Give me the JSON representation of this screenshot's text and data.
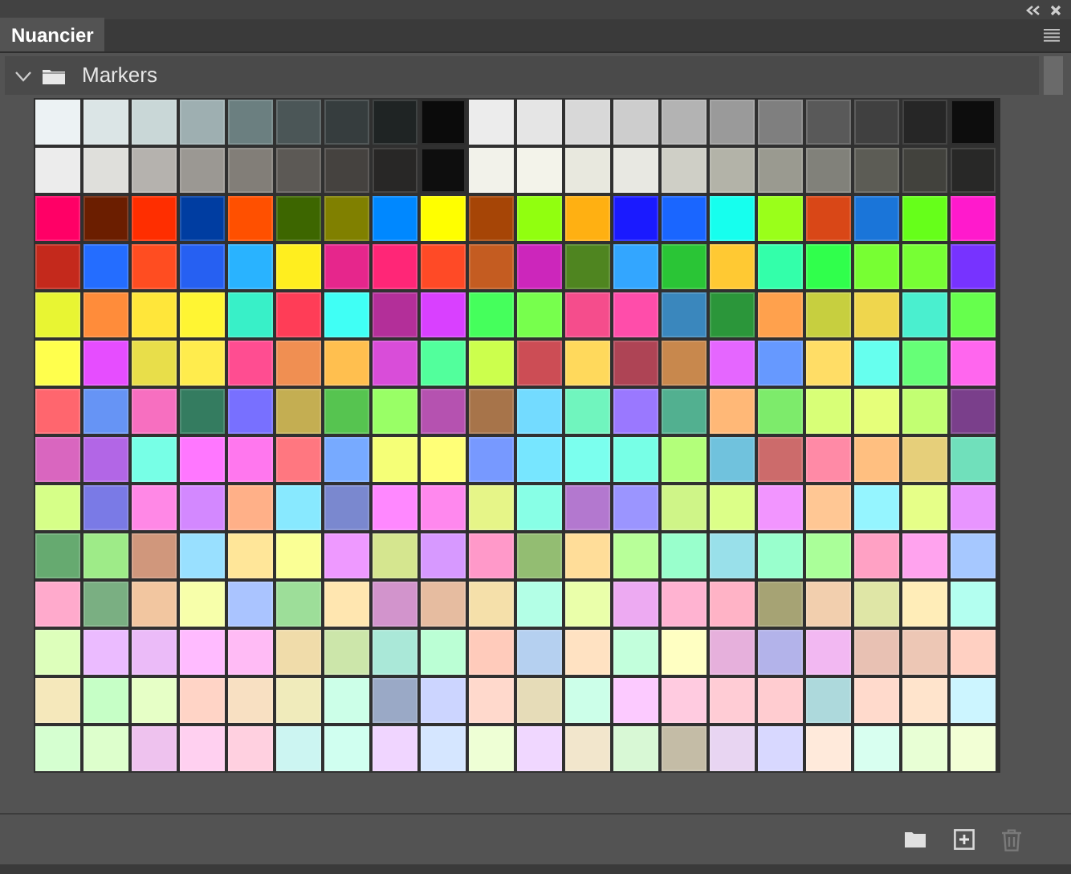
{
  "tab": {
    "title": "Nuancier",
    "selected": true
  },
  "group": {
    "name": "Markers",
    "expanded": true
  },
  "rows": [
    {
      "swatches": [
        {
          "color": "#ecf2f4"
        },
        {
          "color": "#dbe5e6"
        },
        {
          "color": "#c9d7d7"
        },
        {
          "color": "#9eafb1"
        },
        {
          "color": "#6b7f80"
        },
        {
          "color": "#4b5657"
        },
        {
          "color": "#363d3e"
        },
        {
          "color": "#1f2424"
        },
        {
          "color": "#0b0b0b"
        },
        {
          "color": "#ececec"
        },
        {
          "color": "#e5e5e5"
        },
        {
          "color": "#d8d8d8"
        },
        {
          "color": "#cdcdcd"
        },
        {
          "color": "#b3b3b3"
        },
        {
          "color": "#9a9a9a"
        },
        {
          "color": "#7f7f7f"
        },
        {
          "color": "#595959"
        },
        {
          "color": "#404040"
        },
        {
          "color": "#262626"
        },
        {
          "color": "#0d0d0d"
        }
      ]
    },
    {
      "swatches": [
        {
          "color": "#ececec"
        },
        {
          "color": "#dfdfdb"
        },
        {
          "color": "#b5b2ae"
        },
        {
          "color": "#9b9893"
        },
        {
          "color": "#827e78"
        },
        {
          "color": "#5c5955"
        },
        {
          "color": "#45423f"
        },
        {
          "color": "#282726"
        },
        {
          "color": "#0e0e0e"
        },
        {
          "color": "#f2f2ea"
        },
        {
          "color": "#f3f3ea"
        },
        {
          "color": "#e8e8de"
        },
        {
          "color": "#e8e8e2"
        },
        {
          "color": "#cfcfc6"
        },
        {
          "color": "#b3b3a8"
        },
        {
          "color": "#9a9a90"
        },
        {
          "color": "#81817a"
        },
        {
          "color": "#5c5c55"
        },
        {
          "color": "#42423d"
        },
        {
          "color": "#282827"
        }
      ]
    },
    {
      "swatches": [
        {
          "color": "#ff0066"
        },
        {
          "color": "#6b1e00"
        },
        {
          "color": "#ff2e00"
        },
        {
          "color": "#003da1"
        },
        {
          "color": "#ff5000"
        },
        {
          "color": "#3d6600"
        },
        {
          "color": "#808000"
        },
        {
          "color": "#0088ff"
        },
        {
          "color": "#ffff00"
        },
        {
          "color": "#a64506"
        },
        {
          "color": "#91ff0f"
        },
        {
          "color": "#ffb012"
        },
        {
          "color": "#1a1aff"
        },
        {
          "color": "#1a66ff"
        },
        {
          "color": "#16ffee"
        },
        {
          "color": "#9aff1a"
        },
        {
          "color": "#d94717"
        },
        {
          "color": "#1a75d9"
        },
        {
          "color": "#66ff1a"
        },
        {
          "color": "#ff1acc"
        }
      ]
    },
    {
      "swatches": [
        {
          "color": "#c4291c"
        },
        {
          "color": "#246dff"
        },
        {
          "color": "#ff4d21"
        },
        {
          "color": "#2660f2"
        },
        {
          "color": "#29b3ff"
        },
        {
          "color": "#ffee1f"
        },
        {
          "color": "#e6268c"
        },
        {
          "color": "#ff2677"
        },
        {
          "color": "#ff4a26"
        },
        {
          "color": "#c45c21"
        },
        {
          "color": "#cc26bb"
        },
        {
          "color": "#4f8520"
        },
        {
          "color": "#33a6ff"
        },
        {
          "color": "#2ac536"
        },
        {
          "color": "#ffc933"
        },
        {
          "color": "#33ffaa"
        },
        {
          "color": "#30ff4c"
        },
        {
          "color": "#77ff33"
        },
        {
          "color": "#77ff34"
        },
        {
          "color": "#7733ff"
        }
      ]
    },
    {
      "swatches": [
        {
          "color": "#e8f533"
        },
        {
          "color": "#ff8c3a"
        },
        {
          "color": "#ffe63a"
        },
        {
          "color": "#fff533"
        },
        {
          "color": "#38f0c8"
        },
        {
          "color": "#ff3d57"
        },
        {
          "color": "#40fff5"
        },
        {
          "color": "#b32f99"
        },
        {
          "color": "#d940ff"
        },
        {
          "color": "#45ff5c"
        },
        {
          "color": "#77ff4d"
        },
        {
          "color": "#f54d8c"
        },
        {
          "color": "#ff4daa"
        },
        {
          "color": "#3a87bd"
        },
        {
          "color": "#2b963a"
        },
        {
          "color": "#ffa14d"
        },
        {
          "color": "#c7cf3f"
        },
        {
          "color": "#efd64d"
        },
        {
          "color": "#4aefcf"
        },
        {
          "color": "#66ff4d"
        }
      ]
    },
    {
      "swatches": [
        {
          "color": "#ffff4d"
        },
        {
          "color": "#e64dff"
        },
        {
          "color": "#e8de4a"
        },
        {
          "color": "#ffec4d"
        },
        {
          "color": "#ff4d91"
        },
        {
          "color": "#f08f52"
        },
        {
          "color": "#ffbf4f"
        },
        {
          "color": "#d94dd9"
        },
        {
          "color": "#52ff9c"
        },
        {
          "color": "#ccff4d"
        },
        {
          "color": "#cc4d55"
        },
        {
          "color": "#ffd95c"
        },
        {
          "color": "#ae4455"
        },
        {
          "color": "#c8884d"
        },
        {
          "color": "#e566ff"
        },
        {
          "color": "#6699ff"
        },
        {
          "color": "#ffdd66"
        },
        {
          "color": "#66ffee"
        },
        {
          "color": "#66ff77"
        },
        {
          "color": "#ff66ee"
        }
      ]
    },
    {
      "swatches": [
        {
          "color": "#ff666e"
        },
        {
          "color": "#6694f5"
        },
        {
          "color": "#f76fc0"
        },
        {
          "color": "#347c60"
        },
        {
          "color": "#7870ff"
        },
        {
          "color": "#c4ae52"
        },
        {
          "color": "#56c450"
        },
        {
          "color": "#99ff66"
        },
        {
          "color": "#b552b0"
        },
        {
          "color": "#a7744a"
        },
        {
          "color": "#73dbff"
        },
        {
          "color": "#70f5be"
        },
        {
          "color": "#9a78ff"
        },
        {
          "color": "#52b090"
        },
        {
          "color": "#ffb877"
        },
        {
          "color": "#7deb6b"
        },
        {
          "color": "#d8ff77"
        },
        {
          "color": "#e6ff7a"
        },
        {
          "color": "#c2ff72"
        },
        {
          "color": "#7a3f8b"
        }
      ]
    },
    {
      "swatches": [
        {
          "color": "#d966bf"
        },
        {
          "color": "#b266e6"
        },
        {
          "color": "#77ffe6"
        },
        {
          "color": "#ff77ff"
        },
        {
          "color": "#ff77ee"
        },
        {
          "color": "#ff7780"
        },
        {
          "color": "#77aaff"
        },
        {
          "color": "#f5ff77"
        },
        {
          "color": "#ffff77"
        },
        {
          "color": "#7799ff"
        },
        {
          "color": "#77e6ff"
        },
        {
          "color": "#7bffee"
        },
        {
          "color": "#77ffe6"
        },
        {
          "color": "#b3ff7a"
        },
        {
          "color": "#70c2dd"
        },
        {
          "color": "#cc6b6b"
        },
        {
          "color": "#ff8aa6"
        },
        {
          "color": "#ffbf80"
        },
        {
          "color": "#e6cf7a"
        },
        {
          "color": "#70e0bb"
        }
      ]
    },
    {
      "swatches": [
        {
          "color": "#d6ff88"
        },
        {
          "color": "#7a7ae6"
        },
        {
          "color": "#ff88e6"
        },
        {
          "color": "#d388ff"
        },
        {
          "color": "#ffb088"
        },
        {
          "color": "#88e9ff"
        },
        {
          "color": "#7a88cf"
        },
        {
          "color": "#ff88ff"
        },
        {
          "color": "#ff88ee"
        },
        {
          "color": "#e6f588"
        },
        {
          "color": "#88ffe6"
        },
        {
          "color": "#b378cf"
        },
        {
          "color": "#9b95ff"
        },
        {
          "color": "#cff588"
        },
        {
          "color": "#dcff88"
        },
        {
          "color": "#f295ff"
        },
        {
          "color": "#ffc794"
        },
        {
          "color": "#95f5ff"
        },
        {
          "color": "#e6ff88"
        },
        {
          "color": "#e895ff"
        }
      ]
    },
    {
      "swatches": [
        {
          "color": "#66aa70"
        },
        {
          "color": "#9eeb88"
        },
        {
          "color": "#d0977c"
        },
        {
          "color": "#99e0ff"
        },
        {
          "color": "#ffe699"
        },
        {
          "color": "#faff95"
        },
        {
          "color": "#ee99ff"
        },
        {
          "color": "#d5e68f"
        },
        {
          "color": "#d799ff"
        },
        {
          "color": "#ff99c9"
        },
        {
          "color": "#93bd72"
        },
        {
          "color": "#ffdd99"
        },
        {
          "color": "#b8ff99"
        },
        {
          "color": "#99ffcc"
        },
        {
          "color": "#99e0ea"
        },
        {
          "color": "#99ffcd"
        },
        {
          "color": "#aaff99"
        },
        {
          "color": "#ffa1c4"
        },
        {
          "color": "#ffa3ee"
        },
        {
          "color": "#a6c8ff"
        }
      ]
    },
    {
      "swatches": [
        {
          "color": "#ffaacc"
        },
        {
          "color": "#7aaf82"
        },
        {
          "color": "#f2c6a0"
        },
        {
          "color": "#f7ffaa"
        },
        {
          "color": "#aac4ff"
        },
        {
          "color": "#9dde99"
        },
        {
          "color": "#ffe6b0"
        },
        {
          "color": "#d294cc"
        },
        {
          "color": "#e6bca0"
        },
        {
          "color": "#f5e0aa"
        },
        {
          "color": "#b3ffe6"
        },
        {
          "color": "#eaffaa"
        },
        {
          "color": "#edaaf2"
        },
        {
          "color": "#ffb3d1"
        },
        {
          "color": "#ffb3c6"
        },
        {
          "color": "#a6a374"
        },
        {
          "color": "#f2cfae"
        },
        {
          "color": "#dfe6a6"
        },
        {
          "color": "#ffedb8"
        },
        {
          "color": "#b3fff0"
        }
      ]
    },
    {
      "swatches": [
        {
          "color": "#ddffbb"
        },
        {
          "color": "#ebbbff"
        },
        {
          "color": "#ebbbf8"
        },
        {
          "color": "#ffbbff"
        },
        {
          "color": "#ffbbf5"
        },
        {
          "color": "#f0dcaa"
        },
        {
          "color": "#cce6aa"
        },
        {
          "color": "#aae8d8"
        },
        {
          "color": "#bbffd5"
        },
        {
          "color": "#ffcbbb"
        },
        {
          "color": "#b5d0f0"
        },
        {
          "color": "#ffe2c2"
        },
        {
          "color": "#c2ffdc"
        },
        {
          "color": "#ffffc2"
        },
        {
          "color": "#e6b0dc"
        },
        {
          "color": "#b3b3ea"
        },
        {
          "color": "#f2b8f2"
        },
        {
          "color": "#e8c1b3"
        },
        {
          "color": "#edc7b5"
        },
        {
          "color": "#ffd0c2"
        }
      ]
    },
    {
      "swatches": [
        {
          "color": "#f5e8bb"
        },
        {
          "color": "#c6ffc6"
        },
        {
          "color": "#e6ffc6"
        },
        {
          "color": "#ffd4c6"
        },
        {
          "color": "#f8e0c2"
        },
        {
          "color": "#f0ebbb"
        },
        {
          "color": "#ccffe8"
        },
        {
          "color": "#9aa9c6"
        },
        {
          "color": "#ccd5ff"
        },
        {
          "color": "#ffd9cc"
        },
        {
          "color": "#e6dcb8"
        },
        {
          "color": "#ccffe9"
        },
        {
          "color": "#fccaff"
        },
        {
          "color": "#ffcbe0"
        },
        {
          "color": "#ffccd5"
        },
        {
          "color": "#ffccd0"
        },
        {
          "color": "#add9dc"
        },
        {
          "color": "#ffdacc"
        },
        {
          "color": "#ffe4cc"
        },
        {
          "color": "#ccf5ff"
        }
      ]
    },
    {
      "swatches": [
        {
          "color": "#d5ffd0"
        },
        {
          "color": "#ddffcc"
        },
        {
          "color": "#eec2ee"
        },
        {
          "color": "#ffd0f0"
        },
        {
          "color": "#ffd0e0"
        },
        {
          "color": "#ccf5f2"
        },
        {
          "color": "#d0fff0"
        },
        {
          "color": "#f0d5ff"
        },
        {
          "color": "#d5e6ff"
        },
        {
          "color": "#eeffd5"
        },
        {
          "color": "#f0d7ff"
        },
        {
          "color": "#f2e6cc"
        },
        {
          "color": "#d8f8d5"
        },
        {
          "color": "#c4bca6"
        },
        {
          "color": "#e8d5f2"
        },
        {
          "color": "#d8d8ff"
        },
        {
          "color": "#ffeadb"
        },
        {
          "color": "#d8fff0"
        },
        {
          "color": "#e8ffd5"
        },
        {
          "color": "#f2ffd5"
        }
      ]
    }
  ],
  "footer": {
    "delete_disabled": true
  }
}
